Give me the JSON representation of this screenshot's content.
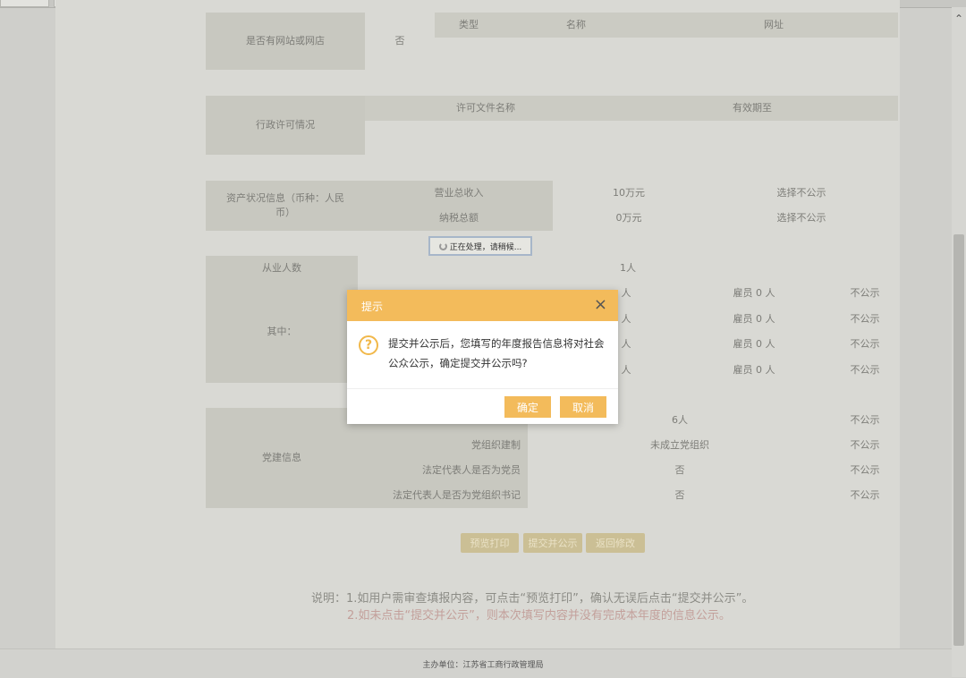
{
  "browser": {
    "tab_count": 6
  },
  "web_section": {
    "label": "是否有网站或网店",
    "value": "否",
    "headers": [
      "类型",
      "名称",
      "网址"
    ]
  },
  "license_section": {
    "label": "行政许可情况",
    "headers": [
      "许可文件名称",
      "有效期至"
    ]
  },
  "assets_section": {
    "label": "资产状况信息（币种：人民币）",
    "rows": [
      {
        "name": "营业总收入",
        "value": "10万元",
        "status": "选择不公示"
      },
      {
        "name": "纳税总额",
        "value": "0万元",
        "status": "选择不公示"
      }
    ]
  },
  "processing_text": "正在处理，请稍候...",
  "employees_section": {
    "label": "从业人数",
    "value": "1人",
    "sub_label": "其中：",
    "sub_rows": [
      {
        "left": "人",
        "mid": "雇员 0 人",
        "right": "不公示"
      },
      {
        "left": "人",
        "mid": "雇员 0 人",
        "right": "不公示"
      },
      {
        "left": "人",
        "mid": "雇员 0 人",
        "right": "不公示"
      },
      {
        "left": "人",
        "mid": "雇员 0 人",
        "right": "不公示"
      }
    ]
  },
  "party_section": {
    "label": "党建信息",
    "rows": [
      {
        "name": "",
        "value": "6人",
        "status": "不公示"
      },
      {
        "name": "党组织建制",
        "value": "未成立党组织",
        "status": "不公示"
      },
      {
        "name": "法定代表人是否为党员",
        "value": "否",
        "status": "不公示"
      },
      {
        "name": "法定代表人是否为党组织书记",
        "value": "否",
        "status": "不公示"
      }
    ]
  },
  "actions": {
    "preview_print": "预览打印",
    "submit_publish": "提交并公示",
    "back_modify": "返回修改"
  },
  "notes": {
    "line1": "说明：1.如用户需审查填报内容，可点击“预览打印”，确认无误后点击“提交并公示”。",
    "line2": "2.如未点击“提交并公示”，则本次填写内容并没有完成本年度的信息公示。"
  },
  "footer": {
    "host": "主办单位：江苏省工商行政管理局"
  },
  "modal": {
    "title": "提示",
    "close": "×",
    "message": "提交并公示后，您填写的年度报告信息将对社会公众公示，确定提交并公示吗?",
    "confirm": "确定",
    "cancel": "取消"
  },
  "colors": {
    "modal_header": "#f3bb5b",
    "note_red": "#c3a09b"
  }
}
